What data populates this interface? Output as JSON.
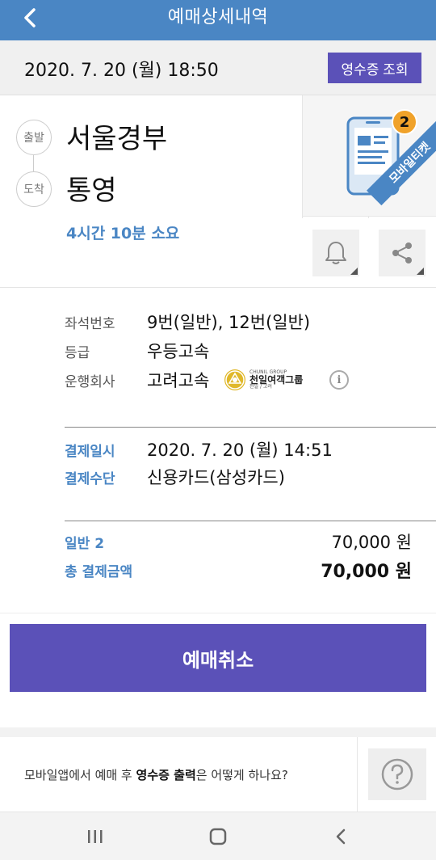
{
  "header": {
    "title": "예매상세내역"
  },
  "date_bar": {
    "date": "2020. 7. 20 (월) 18:50",
    "receipt_button": "영수증 조회"
  },
  "route": {
    "departure_tag": "출발",
    "arrival_tag": "도착",
    "departure": "서울경부",
    "arrival": "통영",
    "duration": "4시간 10분 소요"
  },
  "mobile_ticket": {
    "label": "모바일티켓",
    "count": "2"
  },
  "details": {
    "seat_label": "좌석번호",
    "seat_value": "9번(일반), 12번(일반)",
    "grade_label": "등급",
    "grade_value": "우등고속",
    "company_label": "운행회사",
    "company_value": "고려고속",
    "company_logo_small": "CHUNIL GROUP",
    "company_logo_main": "천일여객그룹",
    "company_logo_sub": "천일 / 고려"
  },
  "payment": {
    "date_label": "결제일시",
    "date_value": "2020. 7. 20 (월) 14:51",
    "method_label": "결제수단",
    "method_value": "신용카드(삼성카드)"
  },
  "amounts": {
    "general_label": "일반 2",
    "general_value": "70,000 원",
    "total_label": "총 결제금액",
    "total_value": "70,000 원"
  },
  "cancel_button": "예매취소",
  "faq": {
    "prefix": "모바일앱에서 예매 후 ",
    "highlight": "영수증 출력",
    "suffix": "은 어떻게 하나요?"
  },
  "colors": {
    "header": "#4a86c4",
    "accent": "#5b51b8",
    "badge": "#f0a22a"
  }
}
